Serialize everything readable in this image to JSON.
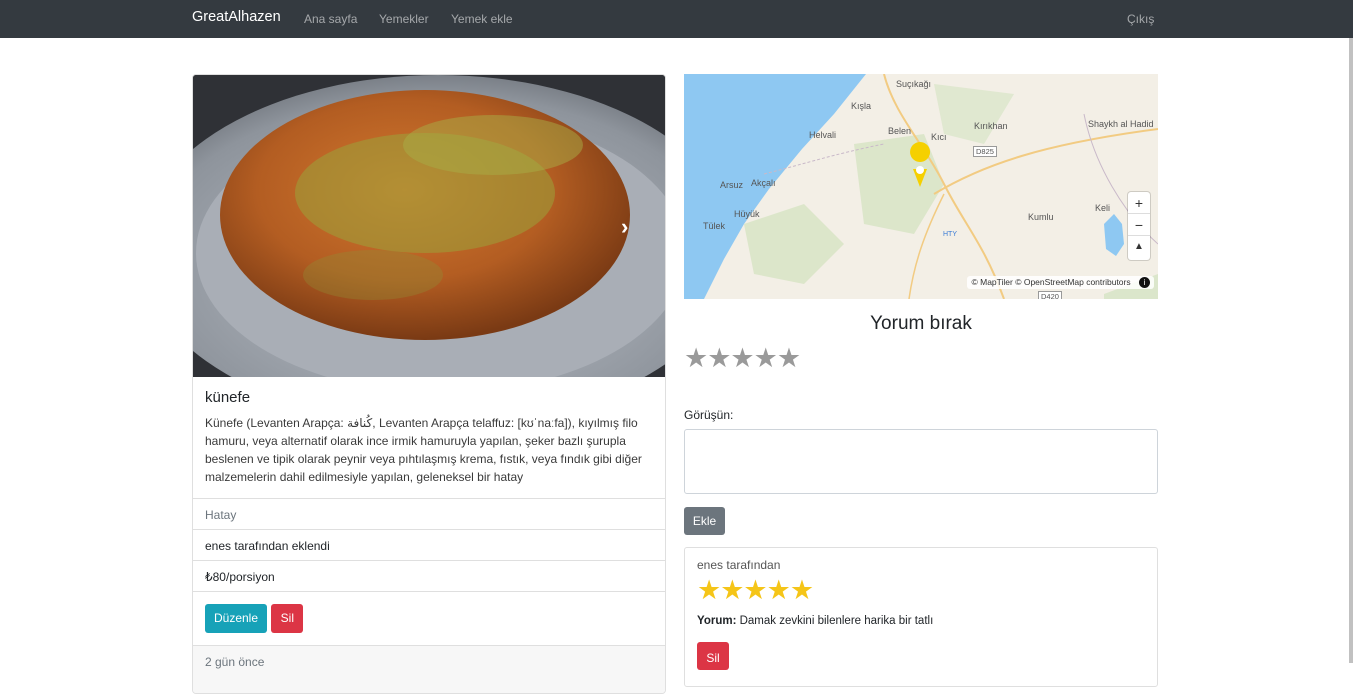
{
  "navbar": {
    "brand": "GreatAlhazen",
    "links": [
      "Ana sayfa",
      "Yemekler",
      "Yemek ekle"
    ],
    "logout": "Çıkış"
  },
  "food": {
    "name": "künefe",
    "description": "Künefe (Levanten Arapça: كُنافة, Levanten Arapça telaffuz: [kʊˈnaːfa]), kıyılmış filo hamuru, veya alternatif olarak ince irmik hamuruyla yapılan, şeker bazlı şurupla beslenen ve tipik olarak peynir veya pıhtılaşmış krema, fıstık, veya fındık gibi diğer malzemelerin dahil edilmesiyle yapılan, geleneksel bir hatay",
    "region": "Hatay",
    "added_by": "enes tarafından eklendi",
    "price": "₺80/porsiyon",
    "edit_label": "Düzenle",
    "delete_label": "Sil",
    "time_ago": "2 gün önce"
  },
  "map": {
    "places": [
      "Suçıkağı",
      "Kışla",
      "Helvali",
      "Belen",
      "Kırıkhan",
      "Shaykh al Hadid",
      "Kıcı",
      "Arsuz",
      "Akçalı",
      "Hüyük",
      "Tülek",
      "Kumlu",
      "Keli",
      "HTY"
    ],
    "roads": [
      "D825",
      "D420"
    ],
    "zoom_in": "+",
    "zoom_out": "−",
    "compass": "▲",
    "attribution": "© MapTiler © OpenStreetMap contributors",
    "info": "i"
  },
  "review": {
    "title": "Yorum bırak",
    "rating_stars": "★★★★★",
    "field_label": "Görüşün:",
    "submit_label": "Ekle"
  },
  "comments": [
    {
      "author": "enes tarafından",
      "stars": "★★★★★",
      "rating": 5,
      "label": "Yorum:",
      "text": "Damak zevkini bilenlere harika bir tatlı",
      "delete_label": "Sil"
    }
  ],
  "colors": {
    "navbar": "#343a40",
    "info": "#17a2b8",
    "danger": "#dc3545",
    "secondary": "#6c757d",
    "star_filled": "#f5c518",
    "star_empty": "#9a9a9a"
  }
}
